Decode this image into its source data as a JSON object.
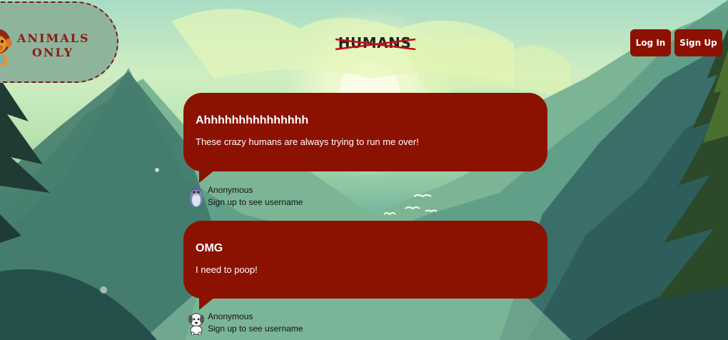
{
  "header": {
    "logo": {
      "line1": "ANIMALS",
      "line2": "ONLY",
      "icon": "monkey-icon"
    },
    "title": "HUMANS",
    "login_label": "Log In",
    "signup_label": "Sign Up"
  },
  "posts": [
    {
      "title": "Ahhhhhhhhhhhhhhh",
      "body": "These crazy humans are always trying to run me over!",
      "author": "Anonymous",
      "author_note": "Sign up to see username",
      "avatar_icon": "penguin-icon"
    },
    {
      "title": "OMG",
      "body": "I need to poop!",
      "author": "Anonymous",
      "author_note": "Sign up to see username",
      "avatar_icon": "dog-icon"
    }
  ],
  "colors": {
    "accent": "#8b1100",
    "logo_text": "#8b1a10",
    "strike": "#c01010"
  }
}
